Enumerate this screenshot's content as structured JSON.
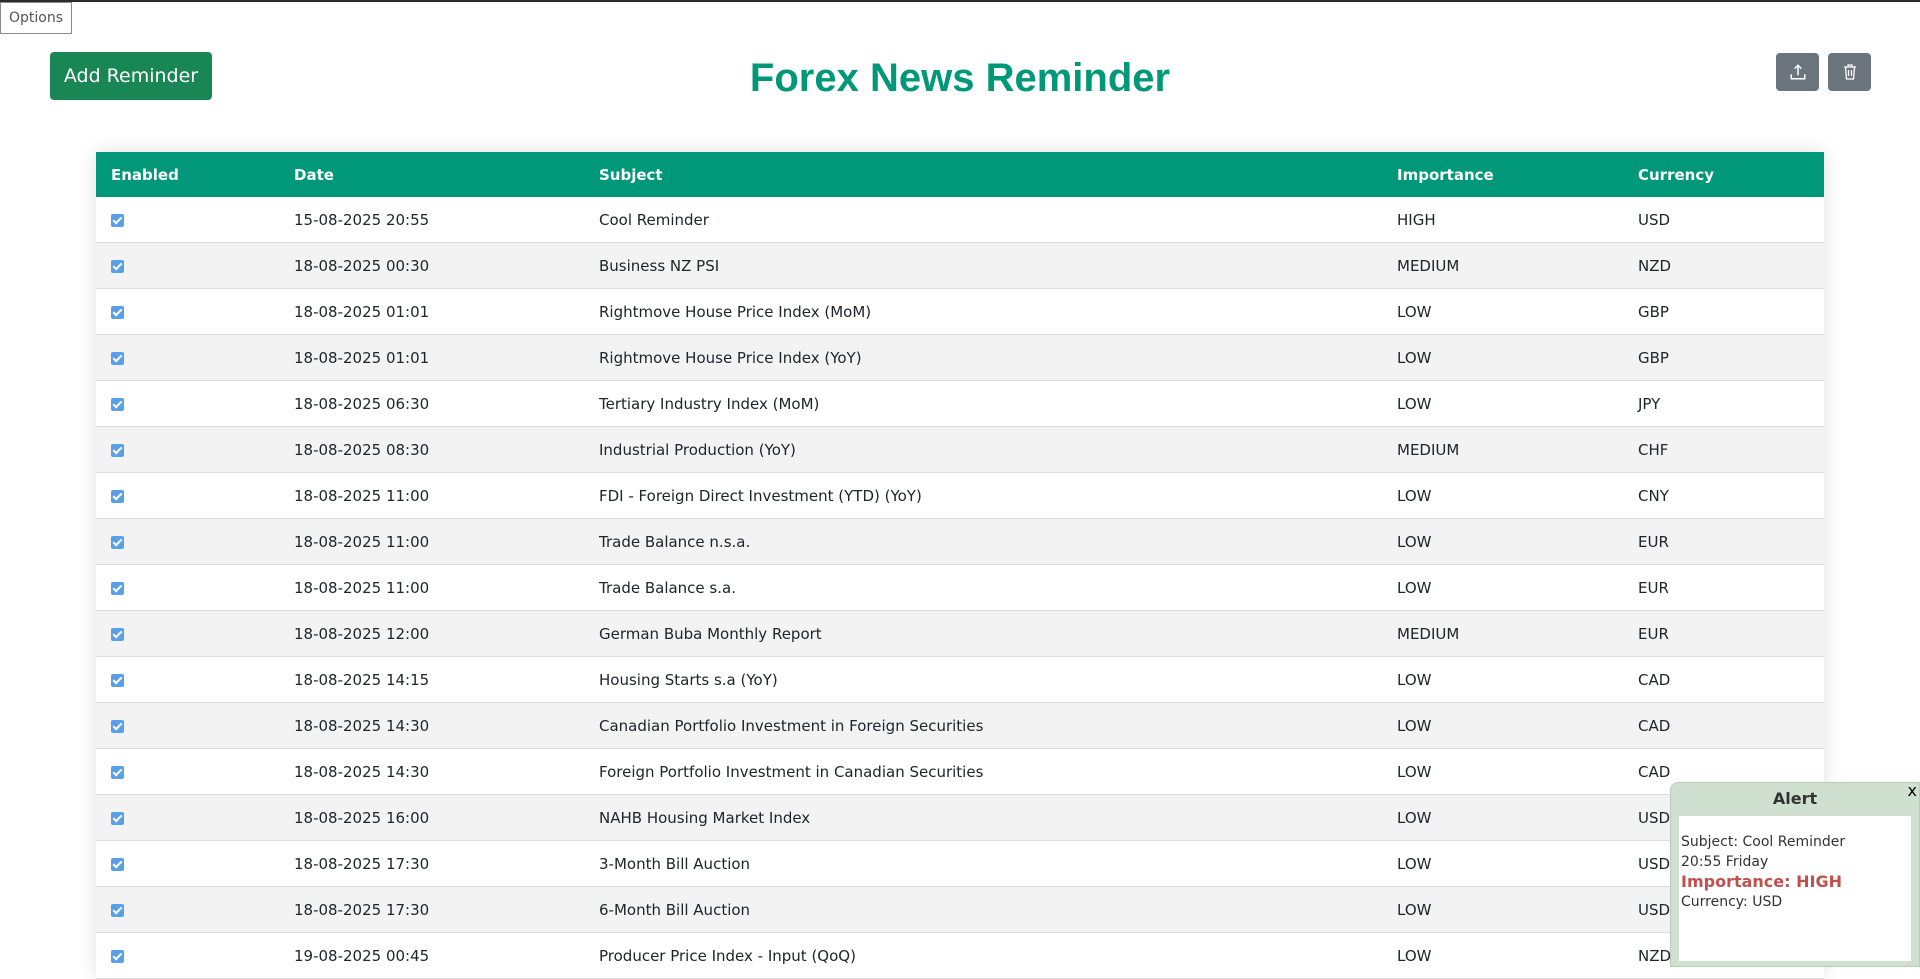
{
  "options_label": "Options",
  "add_reminder_label": "Add Reminder",
  "title": "Forex News Reminder",
  "icons": {
    "export": "upload-icon",
    "delete": "trash-icon"
  },
  "colors": {
    "accent": "#009879",
    "add_button": "#198754",
    "icon_button": "#6c757d",
    "alert_importance": "#c0504d"
  },
  "table": {
    "headers": [
      "Enabled",
      "Date",
      "Subject",
      "Importance",
      "Currency"
    ],
    "rows": [
      {
        "enabled": true,
        "date": "15-08-2025 20:55",
        "subject": "Cool Reminder",
        "importance": "HIGH",
        "currency": "USD"
      },
      {
        "enabled": true,
        "date": "18-08-2025 00:30",
        "subject": "Business NZ PSI",
        "importance": "MEDIUM",
        "currency": "NZD"
      },
      {
        "enabled": true,
        "date": "18-08-2025 01:01",
        "subject": "Rightmove House Price Index (MoM)",
        "importance": "LOW",
        "currency": "GBP"
      },
      {
        "enabled": true,
        "date": "18-08-2025 01:01",
        "subject": "Rightmove House Price Index (YoY)",
        "importance": "LOW",
        "currency": "GBP"
      },
      {
        "enabled": true,
        "date": "18-08-2025 06:30",
        "subject": "Tertiary Industry Index (MoM)",
        "importance": "LOW",
        "currency": "JPY"
      },
      {
        "enabled": true,
        "date": "18-08-2025 08:30",
        "subject": "Industrial Production (YoY)",
        "importance": "MEDIUM",
        "currency": "CHF"
      },
      {
        "enabled": true,
        "date": "18-08-2025 11:00",
        "subject": "FDI - Foreign Direct Investment (YTD) (YoY)",
        "importance": "LOW",
        "currency": "CNY"
      },
      {
        "enabled": true,
        "date": "18-08-2025 11:00",
        "subject": "Trade Balance n.s.a.",
        "importance": "LOW",
        "currency": "EUR"
      },
      {
        "enabled": true,
        "date": "18-08-2025 11:00",
        "subject": "Trade Balance s.a.",
        "importance": "LOW",
        "currency": "EUR"
      },
      {
        "enabled": true,
        "date": "18-08-2025 12:00",
        "subject": "German Buba Monthly Report",
        "importance": "MEDIUM",
        "currency": "EUR"
      },
      {
        "enabled": true,
        "date": "18-08-2025 14:15",
        "subject": "Housing Starts s.a (YoY)",
        "importance": "LOW",
        "currency": "CAD"
      },
      {
        "enabled": true,
        "date": "18-08-2025 14:30",
        "subject": "Canadian Portfolio Investment in Foreign Securities",
        "importance": "LOW",
        "currency": "CAD"
      },
      {
        "enabled": true,
        "date": "18-08-2025 14:30",
        "subject": "Foreign Portfolio Investment in Canadian Securities",
        "importance": "LOW",
        "currency": "CAD"
      },
      {
        "enabled": true,
        "date": "18-08-2025 16:00",
        "subject": "NAHB Housing Market Index",
        "importance": "LOW",
        "currency": "USD"
      },
      {
        "enabled": true,
        "date": "18-08-2025 17:30",
        "subject": "3-Month Bill Auction",
        "importance": "LOW",
        "currency": "USD"
      },
      {
        "enabled": true,
        "date": "18-08-2025 17:30",
        "subject": "6-Month Bill Auction",
        "importance": "LOW",
        "currency": "USD"
      },
      {
        "enabled": true,
        "date": "19-08-2025 00:45",
        "subject": "Producer Price Index - Input (QoQ)",
        "importance": "LOW",
        "currency": "NZD"
      }
    ]
  },
  "alert": {
    "title": "Alert",
    "close": "x",
    "subject": "Subject: Cool Reminder",
    "time": "20:55 Friday",
    "importance": "Importance: HIGH",
    "currency": "Currency: USD"
  }
}
